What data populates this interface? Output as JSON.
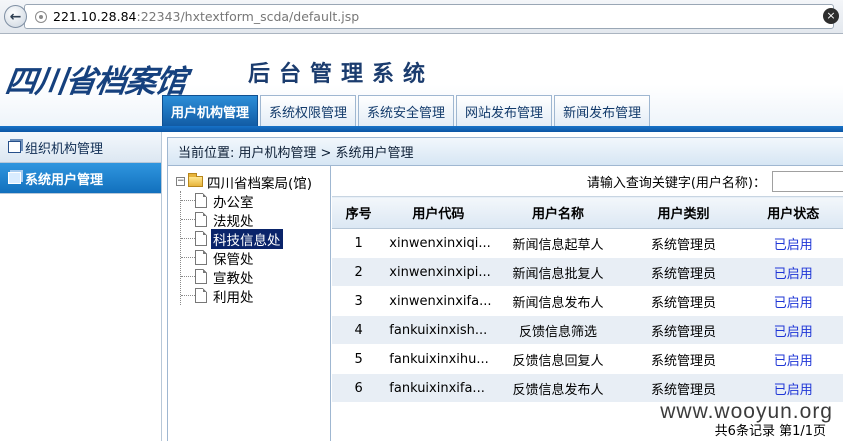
{
  "browser": {
    "url_host": "221.10.28.84",
    "url_rest": ":22343/hxtextform_scda/default.jsp"
  },
  "header": {
    "logo": "四川省档案馆",
    "system_title": "后台管理系统",
    "tabs": [
      {
        "label": "用户机构管理",
        "active": true
      },
      {
        "label": "系统权限管理",
        "active": false
      },
      {
        "label": "系统安全管理",
        "active": false
      },
      {
        "label": "网站发布管理",
        "active": false
      },
      {
        "label": "新闻发布管理",
        "active": false
      }
    ]
  },
  "sidebar": {
    "items": [
      {
        "label": "组织机构管理",
        "active": false
      },
      {
        "label": "系统用户管理",
        "active": true
      }
    ]
  },
  "breadcrumb": {
    "prefix": "当前位置:",
    "path": "用户机构管理 > 系统用户管理"
  },
  "tree": {
    "toggle": "−",
    "root": "四川省档案局(馆)",
    "children": [
      {
        "label": "办公室",
        "selected": false
      },
      {
        "label": "法规处",
        "selected": false
      },
      {
        "label": "科技信息处",
        "selected": true
      },
      {
        "label": "保管处",
        "selected": false
      },
      {
        "label": "宣教处",
        "selected": false
      },
      {
        "label": "利用处",
        "selected": false
      }
    ]
  },
  "search": {
    "label": "请输入查询关键字(用户名称)：",
    "value": ""
  },
  "table": {
    "columns": [
      "序号",
      "用户代码",
      "用户名称",
      "用户类别",
      "用户状态"
    ],
    "rows": [
      [
        "1",
        "xinwenxinxiqi...",
        "新闻信息起草人",
        "系统管理员",
        "已启用"
      ],
      [
        "2",
        "xinwenxinxipi...",
        "新闻信息批复人",
        "系统管理员",
        "已启用"
      ],
      [
        "3",
        "xinwenxinxifa...",
        "新闻信息发布人",
        "系统管理员",
        "已启用"
      ],
      [
        "4",
        "fankuixinxish...",
        "反馈信息筛选",
        "系统管理员",
        "已启用"
      ],
      [
        "5",
        "fankuixinxihu...",
        "反馈信息回复人",
        "系统管理员",
        "已启用"
      ],
      [
        "6",
        "fankuixinxifa...",
        "反馈信息发布人",
        "系统管理员",
        "已启用"
      ]
    ]
  },
  "pager": {
    "text": "共6条记录 第1/1页"
  },
  "watermark": "www.wooyun.org"
}
